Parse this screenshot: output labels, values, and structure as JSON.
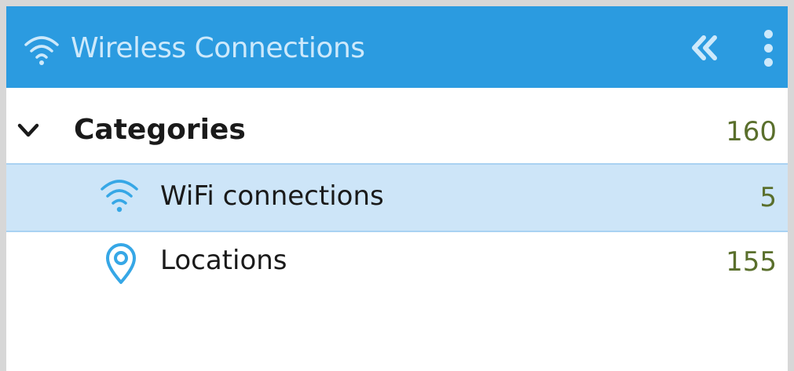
{
  "header": {
    "title": "Wireless Connections",
    "title_icon": "wifi-icon",
    "collapse_icon": "double-chevron-left-icon",
    "menu_icon": "vertical-ellipsis-icon",
    "background_color": "#2b9be0"
  },
  "tree": {
    "categories": {
      "label": "Categories",
      "count": "160",
      "expanded_icon": "chevron-down-icon"
    },
    "items": [
      {
        "label": "WiFi connections",
        "count": "5",
        "icon": "wifi-icon",
        "selected": true
      },
      {
        "label": "Locations",
        "count": "155",
        "icon": "location-pin-icon",
        "selected": false
      }
    ]
  },
  "colors": {
    "selection_background": "#cde5f8",
    "count_text": "#5a6f2c",
    "icon_accent": "#36a7e6"
  }
}
